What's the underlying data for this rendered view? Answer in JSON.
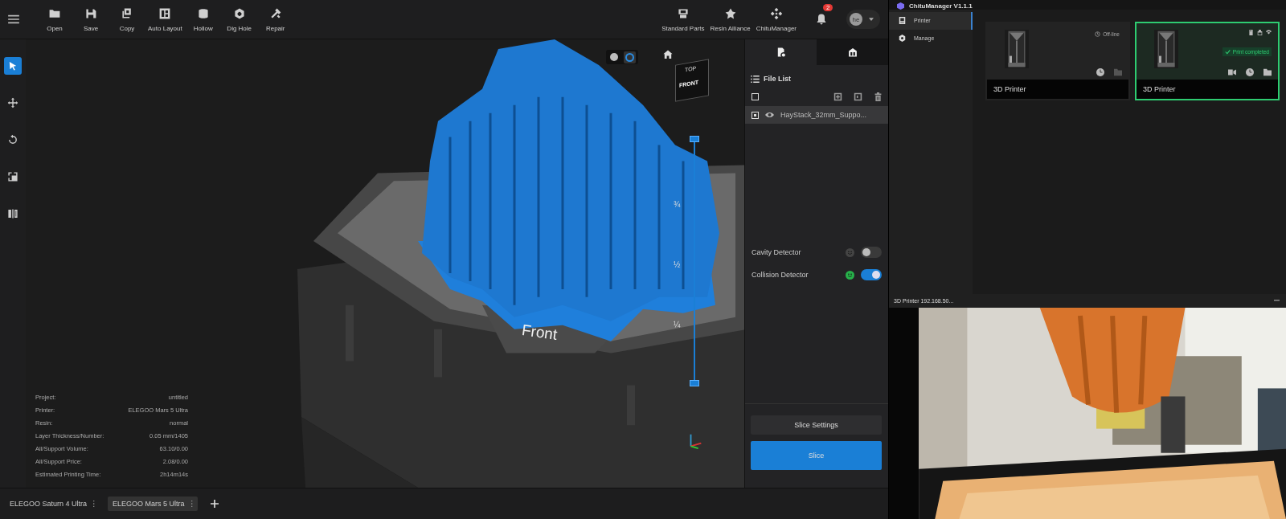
{
  "toolbar": {
    "tools": [
      "Open",
      "Save",
      "Copy",
      "Auto Layout",
      "Hollow",
      "Dig Hole",
      "Repair"
    ],
    "right_tools": [
      "Standard Parts",
      "Resin Alliance",
      "ChituManager"
    ],
    "notification_count": "2",
    "avatar": "he"
  },
  "left_tools": [
    {
      "kind": "select",
      "selected": true
    },
    {
      "kind": "move",
      "selected": false
    },
    {
      "kind": "rotate",
      "selected": false
    },
    {
      "kind": "scale",
      "selected": false
    },
    {
      "kind": "mirror",
      "selected": false
    }
  ],
  "viewport": {
    "render_modes": [
      {
        "kind": "solid",
        "selected": false
      },
      {
        "kind": "wire",
        "selected": true
      }
    ],
    "layer_slider": {
      "level": 1
    },
    "plate_label": "Front",
    "view_cube": {
      "top": "TOP",
      "front": "FRONT"
    },
    "slider_marks": [
      "¾",
      "½",
      "¼"
    ]
  },
  "project_info": [
    {
      "label": "Project:",
      "value": "untitled"
    },
    {
      "label": "Printer:",
      "value": "ELEGOO Mars 5 Ultra"
    },
    {
      "label": "Resin:",
      "value": "normal"
    },
    {
      "label": "Layer Thickness/Number:",
      "value": "0.05 mm/1405"
    },
    {
      "label": "All/Support Volume:",
      "value": "63.10/0.00"
    },
    {
      "label": "All/Support Price:",
      "value": "2.08/0.00"
    },
    {
      "label": "Estimated Printing Time:",
      "value": "2h14m14s"
    }
  ],
  "panel": {
    "tabs": [
      {
        "kind": "files",
        "selected": true
      },
      {
        "kind": "supports",
        "selected": false
      }
    ],
    "section": "File List",
    "all_checked": false,
    "files": [
      {
        "name": "HayStack_32mm_Suppo...",
        "checked": true,
        "visible": true
      }
    ],
    "detectors": [
      {
        "label": "Cavity Detector",
        "on": false
      },
      {
        "label": "Collision Detector",
        "on": true
      }
    ],
    "buttons": [
      {
        "label": "Slice Settings",
        "kind": "secondary"
      },
      {
        "label": "Slice",
        "kind": "primary"
      }
    ]
  },
  "printer_tabs": [
    {
      "label": "ELEGOO Saturn 4 Ultra",
      "selected": false
    },
    {
      "label": "ELEGOO Mars 5 Ultra",
      "selected": true
    }
  ],
  "chitu": {
    "title": "ChituManager V1.1.1",
    "nav": [
      {
        "label": "Printer",
        "selected": true
      },
      {
        "label": "Manage",
        "selected": false
      }
    ],
    "printers": [
      {
        "name": "3D Printer",
        "status": "Off-line",
        "online": false,
        "selected": false
      },
      {
        "name": "3D Printer",
        "status": "Print completed",
        "online": true,
        "selected": true
      }
    ],
    "camera": {
      "title": "3D Printer 192.168.50...",
      "kind": "picture"
    }
  }
}
